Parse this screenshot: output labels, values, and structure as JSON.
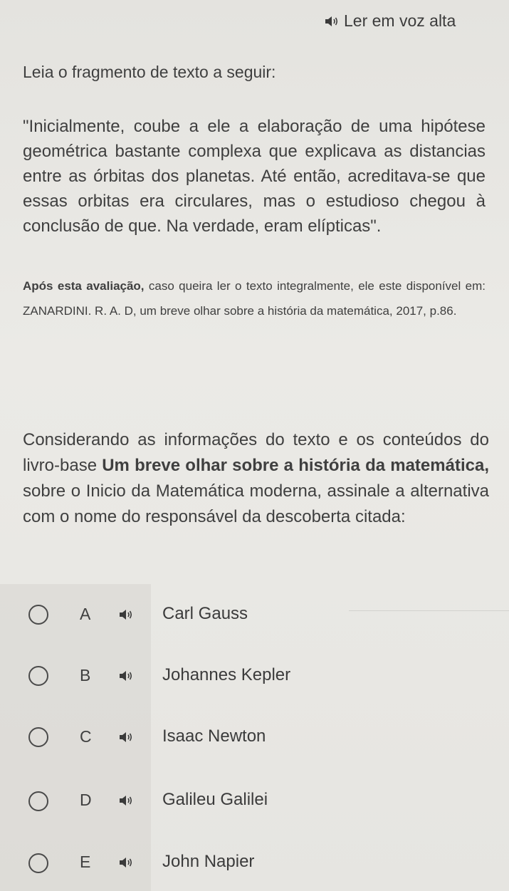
{
  "header": {
    "read_aloud_label": "Ler em voz alta"
  },
  "content": {
    "intro": "Leia o fragmento de texto a seguir:",
    "quote": "\"Inicialmente, coube a ele a elaboração de uma hipótese geométrica bastante complexa que explicava as distancias entre as órbitas dos planetas. Até então, acreditava-se que essas orbitas era circulares, mas o estudioso chegou à conclusão de que. Na verdade, eram elípticas\".",
    "source_bold": "Após esta avaliação,",
    "source_rest": " caso queira ler o texto integralmente, ele este disponível em: ZANARDINI. R. A. D, um breve olhar sobre a história da matemática, 2017, p.86.",
    "question_part1": "Considerando as informações do texto e os conteúdos do livro-base ",
    "question_bold": "Um breve olhar sobre a história da matemática,",
    "question_part2": " sobre o Inicio da Matemática moderna, assinale a alternativa com o nome do responsável da descoberta citada:"
  },
  "options": [
    {
      "letter": "A",
      "text": "Carl Gauss"
    },
    {
      "letter": "B",
      "text": "Johannes Kepler"
    },
    {
      "letter": "C",
      "text": "Isaac Newton"
    },
    {
      "letter": "D",
      "text": "Galileu Galilei"
    },
    {
      "letter": "E",
      "text": "John Napier"
    }
  ],
  "icons": {
    "speaker": "speaker-icon",
    "radio": "radio-button"
  },
  "colors": {
    "text": "#3f3f3f",
    "background": "#e9e8e4"
  }
}
